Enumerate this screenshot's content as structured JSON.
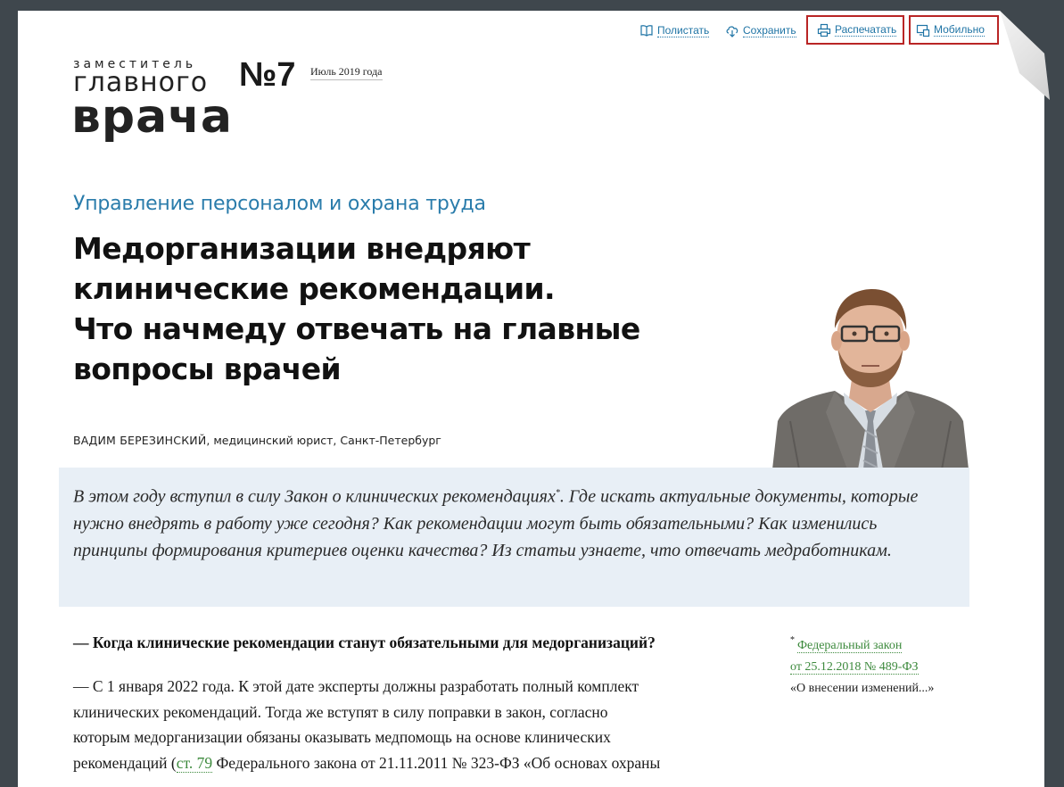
{
  "toolbar": {
    "browse_label": "Полистать",
    "save_label": "Сохранить",
    "print_label": "Распечатать",
    "mobile_label": "Мобильно"
  },
  "logo": {
    "line1": "заместитель",
    "line2": "главного",
    "line3": "врача"
  },
  "issue": {
    "number": "№7",
    "date": "Июль 2019  года"
  },
  "article": {
    "rubric": "Управление персоналом и охрана труда",
    "title_lines": [
      "Медорганизации внедряют",
      "клинические рекомендации.",
      "Что начмеду отвечать на главные",
      "вопросы врачей"
    ],
    "author_name": "ВАДИМ БЕРЕЗИНСКИЙ",
    "author_role": ", медицинский юрист, Санкт-Петербург",
    "lead_before_mark": "В этом году вступил в силу Закон о клинических рекомендациях",
    "lead_mark": "*",
    "lead_after_mark": ". Где искать актуальные документы, которые нужно внедрять в работу уже сегодня? Как рекомендации могут быть обязательными? Как изменились принципы формирования критериев оценки качества? Из статьи узнаете, что отвечать медработникам.",
    "question": "— Когда клинические рекомендации станут обязательными для медорганизаций?",
    "answer_line1": "— С 1 января 2022 года. К этой дате эксперты должны разработать полный комплект",
    "answer_line2": "клинических рекомендаций. Тогда же вступят в силу поправки в закон, согласно",
    "answer_line3": "которым медорганизации обязаны оказывать медпомощь на основе клинических",
    "answer_line4_before": "рекомендаций (",
    "answer_line4_link": "ст. 79",
    "answer_line4_after": " Федерального закона от 21.11.2011 № 323-ФЗ «Об основах охраны"
  },
  "footnote": {
    "mark": "*",
    "link_line1": "Федеральный закон",
    "link_line2": "от 25.12.2018 № 489-ФЗ",
    "description": "«О внесении изменений...»"
  },
  "colors": {
    "accent_blue": "#2a7cab",
    "link_green": "#3d8a3d",
    "highlight_red": "#b92525",
    "lead_bg": "#e8eff6"
  },
  "icons": {
    "browse": "open-book-icon",
    "save": "cloud-download-icon",
    "print": "printer-icon",
    "mobile": "devices-icon"
  }
}
